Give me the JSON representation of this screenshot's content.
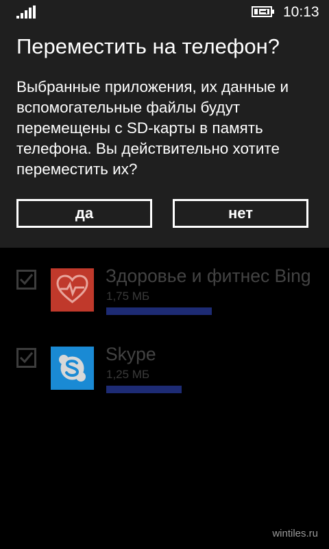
{
  "status_bar": {
    "time": "10:13",
    "signal_icon": "signal-strength-icon",
    "battery_icon": "battery-charging-icon"
  },
  "dialog": {
    "title": "Переместить на телефон?",
    "message": "Выбранные приложения, их данные и вспомогательные файлы будут перемещены с SD-карты в память телефона. Вы действительно хотите переместить их?",
    "yes_label": "да",
    "no_label": "нет"
  },
  "apps": [
    {
      "name": "Здоровье и фитнес Bing",
      "size": "1,75 МБ",
      "checked": true,
      "icon": "health-heart-icon",
      "tile_color": "#c0392b",
      "size_fraction": 0.35
    },
    {
      "name": "Skype",
      "size": "1,25 МБ",
      "checked": true,
      "icon": "skype-icon",
      "tile_color": "#1a8ad4",
      "size_fraction": 0.25
    }
  ],
  "colors": {
    "dialog_background": "#1f1f1f",
    "progress_bar": "#1d2b74"
  },
  "watermark": "wintiles.ru"
}
